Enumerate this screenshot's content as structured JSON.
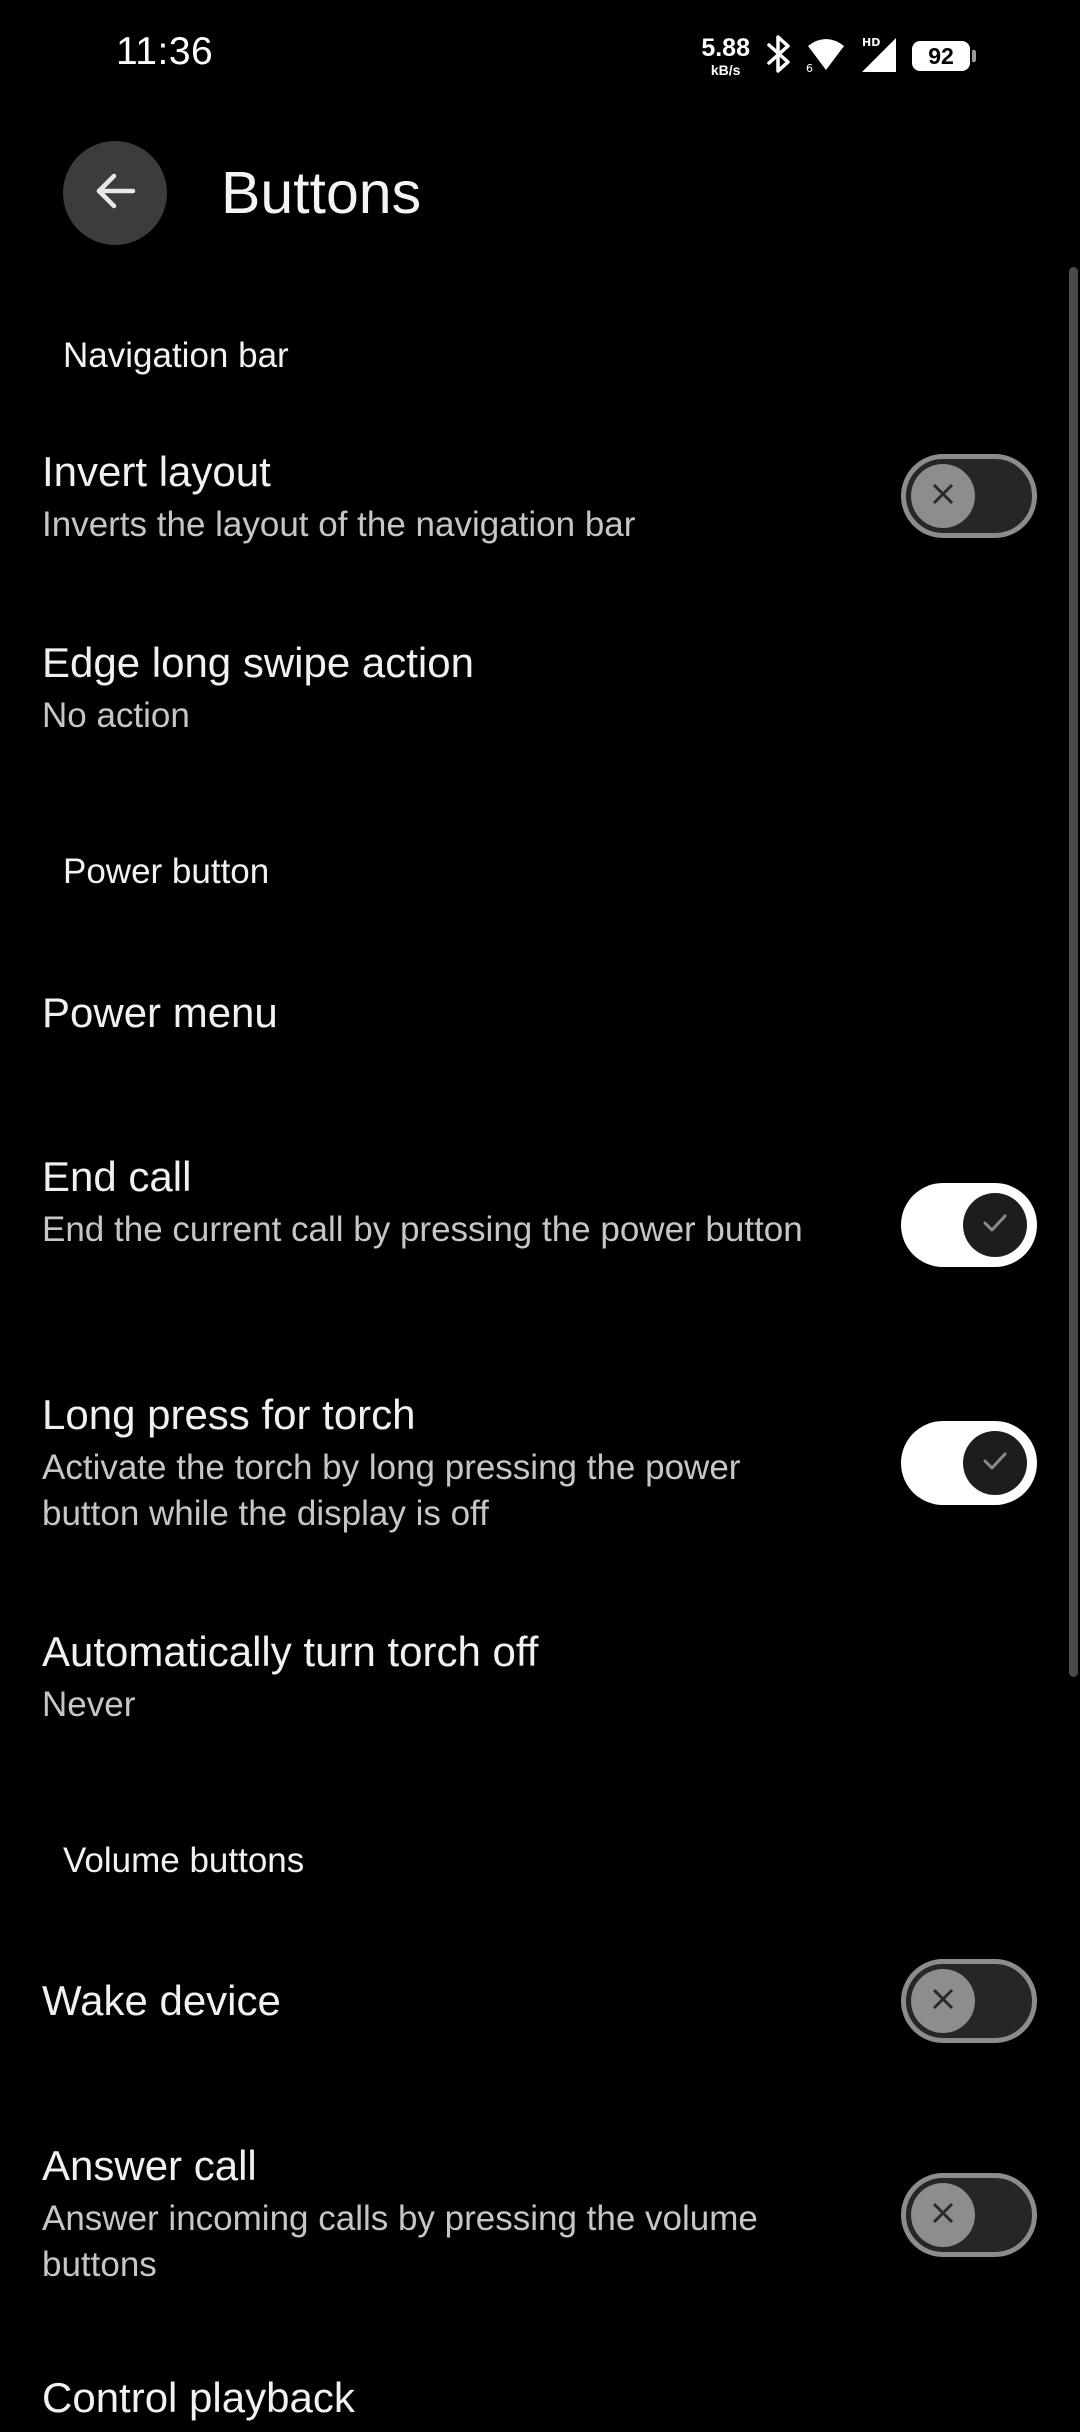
{
  "status_bar": {
    "time": "11:36",
    "net_speed_value": "5.88",
    "net_speed_unit": "kB/s",
    "battery": "92",
    "icons": [
      "bluetooth-icon",
      "wifi-icon",
      "signal-icon"
    ]
  },
  "header": {
    "title": "Buttons"
  },
  "sections": {
    "navigation_bar": {
      "header": "Navigation bar",
      "invert_layout": {
        "title": "Invert layout",
        "summary": "Inverts the layout of the navigation bar",
        "toggle": "off"
      },
      "edge_long_swipe": {
        "title": "Edge long swipe action",
        "summary": "No action"
      }
    },
    "power_button": {
      "header": "Power button",
      "power_menu": {
        "title": "Power menu"
      },
      "end_call": {
        "title": "End call",
        "summary": "End the current call by pressing the power button",
        "toggle": "on"
      },
      "long_press_torch": {
        "title": "Long press for torch",
        "summary": "Activate the torch by long pressing the power button while the display is off",
        "toggle": "on"
      },
      "auto_torch_off": {
        "title": "Automatically turn torch off",
        "summary": "Never"
      }
    },
    "volume_buttons": {
      "header": "Volume buttons",
      "wake_device": {
        "title": "Wake device",
        "toggle": "off"
      },
      "answer_call": {
        "title": "Answer call",
        "summary": "Answer incoming calls by pressing the volume buttons",
        "toggle": "off"
      },
      "control_playback": {
        "title": "Control playback"
      }
    }
  },
  "colors": {
    "background": "#000000",
    "toggle_on_track": "#ffffff",
    "toggle_off_track": "#262626",
    "secondary_text": "#c6c6c6"
  }
}
